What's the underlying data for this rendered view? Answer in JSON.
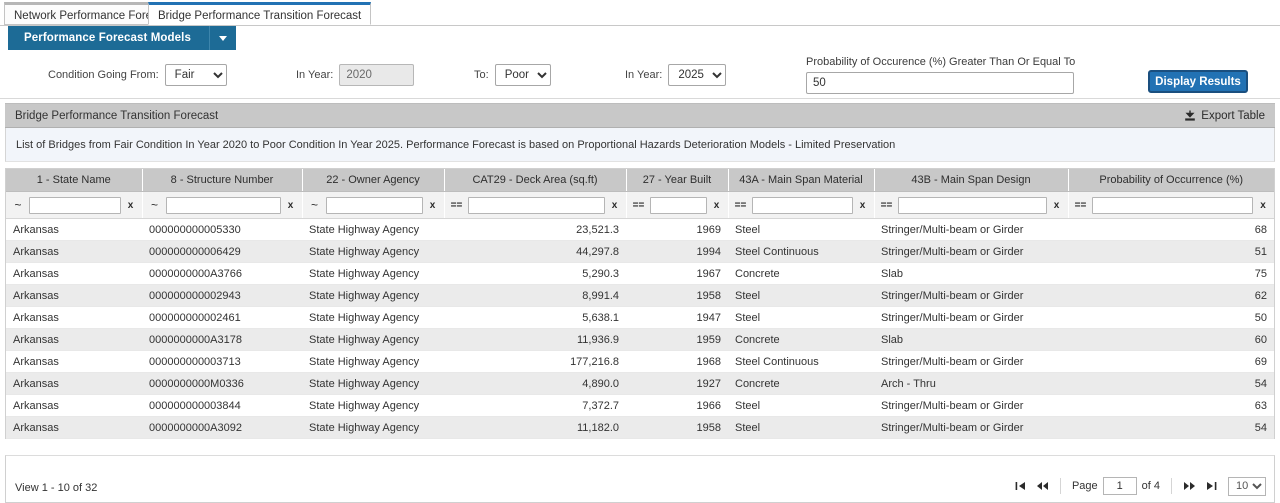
{
  "tabs": [
    {
      "label": "Network Performance Forecast",
      "active": false
    },
    {
      "label": "Bridge Performance Transition Forecast",
      "active": true
    }
  ],
  "toolbar": {
    "models_button": "Performance Forecast Models",
    "caret_icon": "chevron-down-icon"
  },
  "filters": {
    "condition_from_label": "Condition Going From:",
    "condition_from_value": "Fair",
    "condition_from_options": [
      "Fair"
    ],
    "in_year_from_label": "In Year:",
    "in_year_from_value": "2020",
    "condition_to_label": "To:",
    "condition_to_value": "Poor",
    "condition_to_options": [
      "Poor"
    ],
    "in_year_to_label": "In Year:",
    "in_year_to_value": "2025",
    "in_year_to_options": [
      "2025"
    ],
    "probability_label": "Probability of Occurence (%) Greater Than Or Equal To",
    "probability_value": "50",
    "display_results_button": "Display Results"
  },
  "panel": {
    "title": "Bridge Performance Transition Forecast",
    "export_label": "Export Table",
    "export_icon": "download-icon",
    "note": "List of Bridges from Fair Condition In Year 2020 to Poor Condition In Year 2025. Performance Forecast is based on Proportional Hazards Deterioration Models - Limited Preservation"
  },
  "table": {
    "columns": [
      {
        "header": "1 - State Name",
        "operator": "~",
        "filter_value": "",
        "clear": "x"
      },
      {
        "header": "8 - Structure Number",
        "operator": "~",
        "filter_value": "",
        "clear": "x"
      },
      {
        "header": "22 - Owner Agency",
        "operator": "~",
        "filter_value": "",
        "clear": "x"
      },
      {
        "header": "CAT29 - Deck Area (sq.ft)",
        "operator": "==",
        "filter_value": "",
        "clear": "x"
      },
      {
        "header": "27 - Year Built",
        "operator": "==",
        "filter_value": "",
        "clear": "x"
      },
      {
        "header": "43A - Main Span Material",
        "operator": "==",
        "filter_value": "",
        "clear": "x"
      },
      {
        "header": "43B - Main Span Design",
        "operator": "==",
        "filter_value": "",
        "clear": "x"
      },
      {
        "header": "Probability of Occurrence (%)",
        "operator": "==",
        "filter_value": "",
        "clear": "x"
      }
    ],
    "rows": [
      [
        "Arkansas",
        "000000000005330",
        "State Highway Agency",
        "23,521.3",
        "1969",
        "Steel",
        "Stringer/Multi-beam or Girder",
        "68"
      ],
      [
        "Arkansas",
        "000000000006429",
        "State Highway Agency",
        "44,297.8",
        "1994",
        "Steel Continuous",
        "Stringer/Multi-beam or Girder",
        "51"
      ],
      [
        "Arkansas",
        "0000000000A3766",
        "State Highway Agency",
        "5,290.3",
        "1967",
        "Concrete",
        "Slab",
        "75"
      ],
      [
        "Arkansas",
        "000000000002943",
        "State Highway Agency",
        "8,991.4",
        "1958",
        "Steel",
        "Stringer/Multi-beam or Girder",
        "62"
      ],
      [
        "Arkansas",
        "000000000002461",
        "State Highway Agency",
        "5,638.1",
        "1947",
        "Steel",
        "Stringer/Multi-beam or Girder",
        "50"
      ],
      [
        "Arkansas",
        "0000000000A3178",
        "State Highway Agency",
        "11,936.9",
        "1959",
        "Concrete",
        "Slab",
        "60"
      ],
      [
        "Arkansas",
        "000000000003713",
        "State Highway Agency",
        "177,216.8",
        "1968",
        "Steel Continuous",
        "Stringer/Multi-beam or Girder",
        "69"
      ],
      [
        "Arkansas",
        "0000000000M0336",
        "State Highway Agency",
        "4,890.0",
        "1927",
        "Concrete",
        "Arch - Thru",
        "54"
      ],
      [
        "Arkansas",
        "000000000003844",
        "State Highway Agency",
        "7,372.7",
        "1966",
        "Steel",
        "Stringer/Multi-beam or Girder",
        "63"
      ],
      [
        "Arkansas",
        "0000000000A3092",
        "State Highway Agency",
        "11,182.0",
        "1958",
        "Steel",
        "Stringer/Multi-beam or Girder",
        "54"
      ]
    ]
  },
  "footer": {
    "view_text": "View 1 - 10 of 32",
    "first_icon": "first-page-icon",
    "prev_icon": "previous-page-icon",
    "page_label": "Page",
    "page_value": "1",
    "of_label": "of 4",
    "next_icon": "next-page-icon",
    "last_icon": "last-page-icon",
    "page_size_value": "10",
    "page_size_options": [
      "10"
    ]
  },
  "colors": {
    "brand_blue": "#1d6b96",
    "accent_blue": "#2272b4",
    "header_gray": "#c8c8c8",
    "note_bg": "#f2f5fa"
  }
}
